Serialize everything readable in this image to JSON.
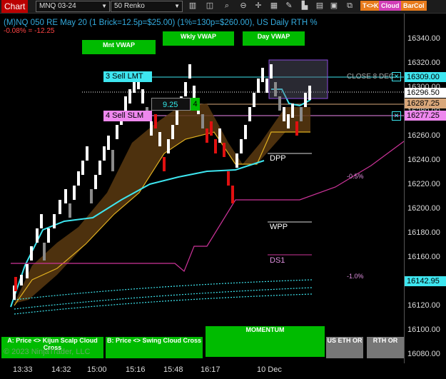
{
  "toolbar": {
    "title": "Chart",
    "instrument": "MNQ 03-24",
    "bar_type": "50 Renko",
    "chips": [
      {
        "label": "T<>K",
        "color": "#e87b1c"
      },
      {
        "label": "Cloud",
        "color": "#d23fb7"
      },
      {
        "label": "BarCol",
        "color": "#e87b1c"
      }
    ]
  },
  "header": {
    "line1": "(M)NQ 050 RE May 20 (1 Brick=12.5p=$25.00) (1%=130p=$260.00), US Daily RTH %",
    "line2": "-0.08% = -12.25"
  },
  "vwap": {
    "month": "Mnt VWAP",
    "week": "Wkly VWAP",
    "day": "Day VWAP"
  },
  "orders": {
    "sell_limit": "3 Sell LMT",
    "sell_stop": "4 Sell SLM",
    "pnl": "9.25",
    "qty": "4"
  },
  "levels": {
    "close": "CLOSE 8 DEC",
    "dpp": "DPP",
    "wpp": "WPP",
    "ds1": "DS1",
    "pct_minus_half": "-0.5%",
    "pct_minus_one": "-1.0%"
  },
  "price_axis": {
    "ticks": [
      "16340.00",
      "16320.00",
      "16300.00",
      "16280.00",
      "16260.00",
      "16240.00",
      "16220.00",
      "16200.00",
      "16180.00",
      "16160.00",
      "16140.00",
      "16120.00",
      "16100.00",
      "16080.00"
    ],
    "labels": [
      {
        "text": "16309.00",
        "bg": "#3ee6f0",
        "fg": "#000"
      },
      {
        "text": "16296.50",
        "bg": "#ffffff",
        "fg": "#000"
      },
      {
        "text": "16287.25",
        "bg": "#d9a77a",
        "fg": "#000"
      },
      {
        "text": "16277.25",
        "bg": "#ee88ee",
        "fg": "#000"
      },
      {
        "text": "16142.95",
        "bg": "#3ee6f0",
        "fg": "#000"
      }
    ]
  },
  "time_axis": [
    "13:33",
    "14:32",
    "15:00",
    "15:16",
    "15:48",
    "16:17",
    "10 Dec"
  ],
  "buttons": {
    "kijun": "A: Price <> Kijun Scalp Cloud Cross",
    "swing": "B: Price <> Swing Cloud Cross",
    "momentum": "MOMENTUM",
    "us_eth": "US ETH OR",
    "rth": "RTH OR"
  },
  "copyright": "© 2023 NinjaTrader, LLC",
  "colors": {
    "bull": "#ffffff",
    "bear": "#e01010",
    "cloud": "#5a3a10",
    "cyan": "#3ee6f0",
    "magenta": "#cc3399"
  }
}
